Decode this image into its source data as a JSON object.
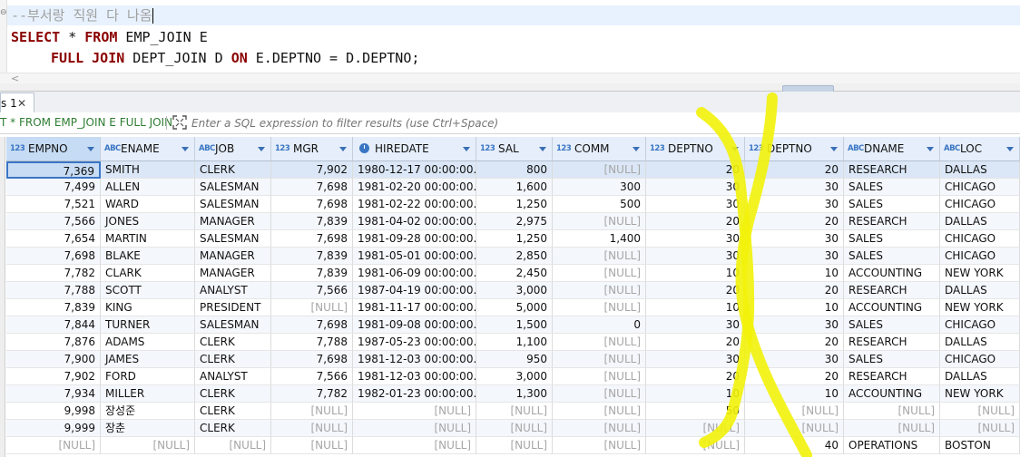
{
  "editor": {
    "line1": "--부서랑 직원 다 나옴",
    "line2": {
      "kw1": "SELECT",
      "plain1": " * ",
      "kw2": "FROM",
      "plain2": " EMP_JOIN E"
    },
    "line3": {
      "kw1": "FULL JOIN",
      "plain1": " DEPT_JOIN D ",
      "kw2": "ON",
      "plain2": " E.DEPTNO = D.DEPTNO;"
    }
  },
  "results_tab": {
    "label": "s 1",
    "close": "✕"
  },
  "filter": {
    "query_text": "T * FROM EMP_JOIN E FULL JOIN",
    "placeholder": "Enter a SQL expression to filter results (use Ctrl+Space)"
  },
  "columns": [
    {
      "type": "123",
      "name": "EMPNO"
    },
    {
      "type": "ABC",
      "name": "ENAME"
    },
    {
      "type": "ABC",
      "name": "JOB"
    },
    {
      "type": "123",
      "name": "MGR"
    },
    {
      "type": "clock",
      "name": "HIREDATE"
    },
    {
      "type": "123",
      "name": "SAL"
    },
    {
      "type": "123",
      "name": "COMM"
    },
    {
      "type": "123",
      "name": "DEPTNO"
    },
    {
      "type": "123",
      "name": "DEPTNO"
    },
    {
      "type": "ABC",
      "name": "DNAME"
    },
    {
      "type": "ABC",
      "name": "LOC"
    }
  ],
  "rows": [
    [
      "7,369",
      "SMITH",
      "CLERK",
      "7,902",
      "1980-12-17 00:00:00.000",
      "800",
      "[NULL]",
      "20",
      "20",
      "RESEARCH",
      "DALLAS"
    ],
    [
      "7,499",
      "ALLEN",
      "SALESMAN",
      "7,698",
      "1981-02-20 00:00:00.000",
      "1,600",
      "300",
      "30",
      "30",
      "SALES",
      "CHICAGO"
    ],
    [
      "7,521",
      "WARD",
      "SALESMAN",
      "7,698",
      "1981-02-22 00:00:00.000",
      "1,250",
      "500",
      "30",
      "30",
      "SALES",
      "CHICAGO"
    ],
    [
      "7,566",
      "JONES",
      "MANAGER",
      "7,839",
      "1981-04-02 00:00:00.000",
      "2,975",
      "[NULL]",
      "20",
      "20",
      "RESEARCH",
      "DALLAS"
    ],
    [
      "7,654",
      "MARTIN",
      "SALESMAN",
      "7,698",
      "1981-09-28 00:00:00.000",
      "1,250",
      "1,400",
      "30",
      "30",
      "SALES",
      "CHICAGO"
    ],
    [
      "7,698",
      "BLAKE",
      "MANAGER",
      "7,839",
      "1981-05-01 00:00:00.000",
      "2,850",
      "[NULL]",
      "30",
      "30",
      "SALES",
      "CHICAGO"
    ],
    [
      "7,782",
      "CLARK",
      "MANAGER",
      "7,839",
      "1981-06-09 00:00:00.000",
      "2,450",
      "[NULL]",
      "10",
      "10",
      "ACCOUNTING",
      "NEW YORK"
    ],
    [
      "7,788",
      "SCOTT",
      "ANALYST",
      "7,566",
      "1987-04-19 00:00:00.000",
      "3,000",
      "[NULL]",
      "20",
      "20",
      "RESEARCH",
      "DALLAS"
    ],
    [
      "7,839",
      "KING",
      "PRESIDENT",
      "[NULL]",
      "1981-11-17 00:00:00.000",
      "5,000",
      "[NULL]",
      "10",
      "10",
      "ACCOUNTING",
      "NEW YORK"
    ],
    [
      "7,844",
      "TURNER",
      "SALESMAN",
      "7,698",
      "1981-09-08 00:00:00.000",
      "1,500",
      "0",
      "30",
      "30",
      "SALES",
      "CHICAGO"
    ],
    [
      "7,876",
      "ADAMS",
      "CLERK",
      "7,788",
      "1987-05-23 00:00:00.000",
      "1,100",
      "[NULL]",
      "20",
      "20",
      "RESEARCH",
      "DALLAS"
    ],
    [
      "7,900",
      "JAMES",
      "CLERK",
      "7,698",
      "1981-12-03 00:00:00.000",
      "950",
      "[NULL]",
      "30",
      "30",
      "SALES",
      "CHICAGO"
    ],
    [
      "7,902",
      "FORD",
      "ANALYST",
      "7,566",
      "1981-12-03 00:00:00.000",
      "3,000",
      "[NULL]",
      "20",
      "20",
      "RESEARCH",
      "DALLAS"
    ],
    [
      "7,934",
      "MILLER",
      "CLERK",
      "7,782",
      "1982-01-23 00:00:00.000",
      "1,300",
      "[NULL]",
      "10",
      "10",
      "ACCOUNTING",
      "NEW YORK"
    ],
    [
      "9,998",
      "장성준",
      "CLERK",
      "[NULL]",
      "[NULL]",
      "[NULL]",
      "[NULL]",
      "50",
      "[NULL]",
      "[NULL]",
      "[NULL]"
    ],
    [
      "9,999",
      "장춘",
      "CLERK",
      "[NULL]",
      "[NULL]",
      "[NULL]",
      "[NULL]",
      "[NULL]",
      "[NULL]",
      "[NULL]",
      "[NULL]"
    ],
    [
      "[NULL]",
      "[NULL]",
      "[NULL]",
      "[NULL]",
      "[NULL]",
      "[NULL]",
      "[NULL]",
      "[NULL]",
      "40",
      "OPERATIONS",
      "BOSTON"
    ]
  ],
  "colors": {
    "keyword": "#8b0000",
    "null_text": "#a6a6a6",
    "header_bg": "#e5eefa",
    "annotation": "#f2f20a"
  }
}
